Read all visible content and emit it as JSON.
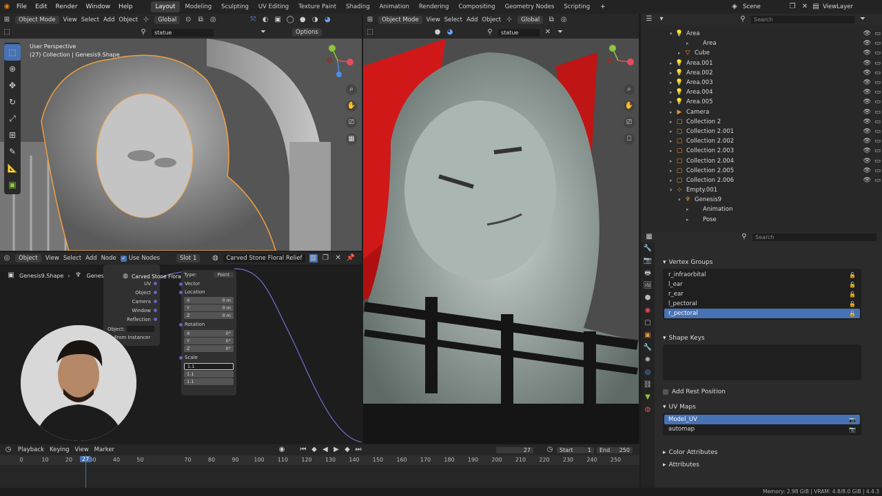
{
  "menubar": {
    "items": [
      "File",
      "Edit",
      "Render",
      "Window",
      "Help"
    ],
    "workspaces": [
      "Layout",
      "Modeling",
      "Sculpting",
      "UV Editing",
      "Texture Paint",
      "Shading",
      "Animation",
      "Rendering",
      "Compositing",
      "Geometry Nodes",
      "Scripting"
    ],
    "active_workspace": "Layout",
    "add_tab": "+",
    "scene": "Scene",
    "view_layer": "ViewLayer"
  },
  "viewport_left": {
    "mode": "Object Mode",
    "menu": [
      "View",
      "Select",
      "Add",
      "Object"
    ],
    "transform": "Global",
    "search_value": "statue",
    "options": "Options",
    "info_line1": "User Perspective",
    "info_line2": "(27) Collection | Genesis9.Shape"
  },
  "viewport_right": {
    "mode": "Object Mode",
    "menu": [
      "View",
      "Select",
      "Add",
      "Object"
    ],
    "transform": "Global",
    "search_value": "statue"
  },
  "outliner": {
    "search_placeholder": "Search",
    "rows": [
      {
        "name": "Area",
        "indent": 1,
        "icon": "light-icon",
        "color": "#e8943a",
        "expanded": true
      },
      {
        "name": "Area",
        "indent": 3,
        "icon": "",
        "color": "#e8943a"
      },
      {
        "name": "Cube",
        "indent": 2,
        "icon": "mesh-icon",
        "color": "#e8943a"
      },
      {
        "name": "Area.001",
        "indent": 1,
        "icon": "light-icon",
        "color": "#e8943a"
      },
      {
        "name": "Area.002",
        "indent": 1,
        "icon": "light-icon",
        "color": "#e8943a"
      },
      {
        "name": "Area.003",
        "indent": 1,
        "icon": "light-icon",
        "color": "#e8943a"
      },
      {
        "name": "Area.004",
        "indent": 1,
        "icon": "light-icon",
        "color": "#e8943a"
      },
      {
        "name": "Area.005",
        "indent": 1,
        "icon": "light-icon",
        "color": "#e8943a"
      },
      {
        "name": "Camera",
        "indent": 1,
        "icon": "camera-icon",
        "color": "#e8943a"
      },
      {
        "name": "Collection 2",
        "indent": 1,
        "icon": "collection-icon",
        "color": "#e8943a"
      },
      {
        "name": "Collection 2.001",
        "indent": 1,
        "icon": "collection-icon",
        "color": "#e8943a"
      },
      {
        "name": "Collection 2.002",
        "indent": 1,
        "icon": "collection-icon",
        "color": "#e8943a"
      },
      {
        "name": "Collection 2.003",
        "indent": 1,
        "icon": "collection-icon",
        "color": "#e8943a"
      },
      {
        "name": "Collection 2.004",
        "indent": 1,
        "icon": "collection-icon",
        "color": "#e8943a"
      },
      {
        "name": "Collection 2.005",
        "indent": 1,
        "icon": "collection-icon",
        "color": "#e8943a"
      },
      {
        "name": "Collection 2.006",
        "indent": 1,
        "icon": "collection-icon",
        "color": "#e8943a"
      },
      {
        "name": "Empty.001",
        "indent": 1,
        "icon": "empty-icon",
        "color": "#e8943a",
        "expanded": true
      },
      {
        "name": "Genesis9",
        "indent": 2,
        "icon": "armature-icon",
        "color": "#e8943a",
        "expanded": true
      },
      {
        "name": "Animation",
        "indent": 3,
        "icon": "",
        "color": "#e8943a"
      },
      {
        "name": "Pose",
        "indent": 3,
        "icon": "",
        "color": "#e8943a"
      }
    ]
  },
  "properties": {
    "search_placeholder": "Search",
    "vertex_groups_title": "Vertex Groups",
    "vertex_groups": [
      "r_infraorbital",
      "l_ear",
      "r_ear",
      "l_pectoral",
      "r_pectoral"
    ],
    "vertex_groups_selected": "r_pectoral",
    "shape_keys_title": "Shape Keys",
    "add_rest_position": "Add Rest Position",
    "uv_maps_title": "UV Maps",
    "uv_maps": [
      "Model_UV",
      "automap"
    ],
    "uv_selected": "Model_UV",
    "color_attributes_title": "Color Attributes",
    "attributes_title": "Attributes"
  },
  "node_editor": {
    "editor": "Object",
    "menu": [
      "View",
      "Select",
      "Add",
      "Node"
    ],
    "use_nodes": "Use Nodes",
    "slot": "Slot 1",
    "material": "Carved Stone Floral Relief",
    "breadcrumb": [
      "Genesis9.Shape",
      "Genesis9",
      "Carved Stone Floral Relief"
    ],
    "tex_coord_outputs": [
      "UV",
      "Object",
      "Camera",
      "Window",
      "Reflection"
    ],
    "object_label": "Object:",
    "from_instancer": "From Instancer",
    "mapping": {
      "type_label": "Type:",
      "type_value": "Point",
      "vector": "Vector",
      "location": "Location",
      "loc": [
        [
          "X",
          "0 m"
        ],
        [
          "Y",
          "0 m"
        ],
        [
          "Z",
          "0 m"
        ]
      ],
      "rotation": "Rotation",
      "rot": [
        [
          "X",
          "0°"
        ],
        [
          "Y",
          "0°"
        ],
        [
          "Z",
          "0°"
        ]
      ],
      "scale": "Scale",
      "scl": [
        "1.1",
        "1.1",
        "1.1"
      ]
    }
  },
  "timeline": {
    "menu": [
      "Playback",
      "Keying",
      "View",
      "Marker"
    ],
    "current_frame": "27",
    "start_label": "Start",
    "start": "1",
    "end_label": "End",
    "end": "250",
    "ticks": [
      "0",
      "10",
      "20",
      "30",
      "40",
      "50",
      "70",
      "80",
      "90",
      "100",
      "110",
      "120",
      "130",
      "140",
      "150",
      "160",
      "170",
      "180",
      "190",
      "200",
      "210",
      "220",
      "230",
      "240",
      "250"
    ],
    "playhead": "27"
  },
  "status": {
    "memory": "Memory: 2.98 GiB | VRAM: 4.8/8.0 GiB | 4.4.3"
  }
}
